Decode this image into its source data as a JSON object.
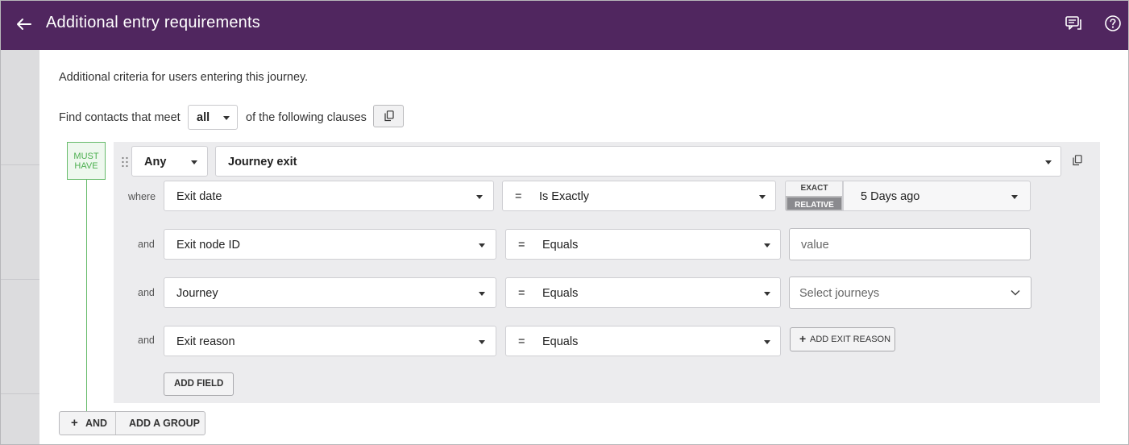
{
  "header": {
    "title": "Additional entry requirements",
    "bg_color": "#50265f",
    "icons": [
      "back-arrow-icon",
      "chat-feedback-icon",
      "help-icon"
    ]
  },
  "description": "Additional criteria for users entering this journey.",
  "find": {
    "prefix": "Find contacts that meet",
    "match_value": "all",
    "suffix": "of the following clauses"
  },
  "group": {
    "badge_line1": "MUST",
    "badge_line2": "HAVE",
    "quantifier": "Any",
    "event": "Journey exit",
    "conditions": [
      {
        "connector": "where",
        "field": "Exit date",
        "operator_symbol": "=",
        "operator": "Is Exactly",
        "date_mode_exact": "EXACT",
        "date_mode_relative": "RELATIVE",
        "date_mode_selected": "RELATIVE",
        "value": "5 Days ago"
      },
      {
        "connector": "and",
        "field": "Exit node ID",
        "operator_symbol": "=",
        "operator": "Equals",
        "value_placeholder": "value"
      },
      {
        "connector": "and",
        "field": "Journey",
        "operator_symbol": "=",
        "operator": "Equals",
        "value_placeholder": "Select journeys"
      },
      {
        "connector": "and",
        "field": "Exit reason",
        "operator_symbol": "=",
        "operator": "Equals",
        "action_label": "ADD EXIT REASON"
      }
    ],
    "add_field_label": "ADD FIELD"
  },
  "footer": {
    "and_label": "AND",
    "add_group_label": "ADD A GROUP"
  },
  "colors": {
    "accent_green": "#4caf50",
    "group_bg": "#ececee"
  }
}
